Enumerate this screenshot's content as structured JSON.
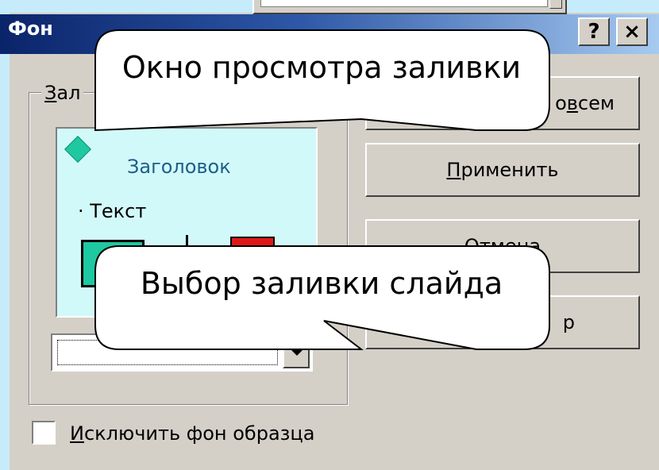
{
  "dialog": {
    "title": "Фон",
    "help_label": "?",
    "close_label": "×"
  },
  "fill_group": {
    "label_prefix": "З",
    "label_rest": "ал"
  },
  "preview": {
    "title": "Заголовок",
    "bullet": "· Текст"
  },
  "buttons": {
    "apply_all_prefix": "о ",
    "apply_all_underlined": "в",
    "apply_all_rest": "сем",
    "apply_underlined": "П",
    "apply_rest": "рименить",
    "cancel_visible": "Отмена",
    "view_visible": "р"
  },
  "checkbox": {
    "label_underlined": "И",
    "label_rest": "сключить фон образца",
    "checked": false
  },
  "callouts": {
    "top": "Окно просмотра заливки",
    "bottom": "Выбор заливки слайда"
  }
}
